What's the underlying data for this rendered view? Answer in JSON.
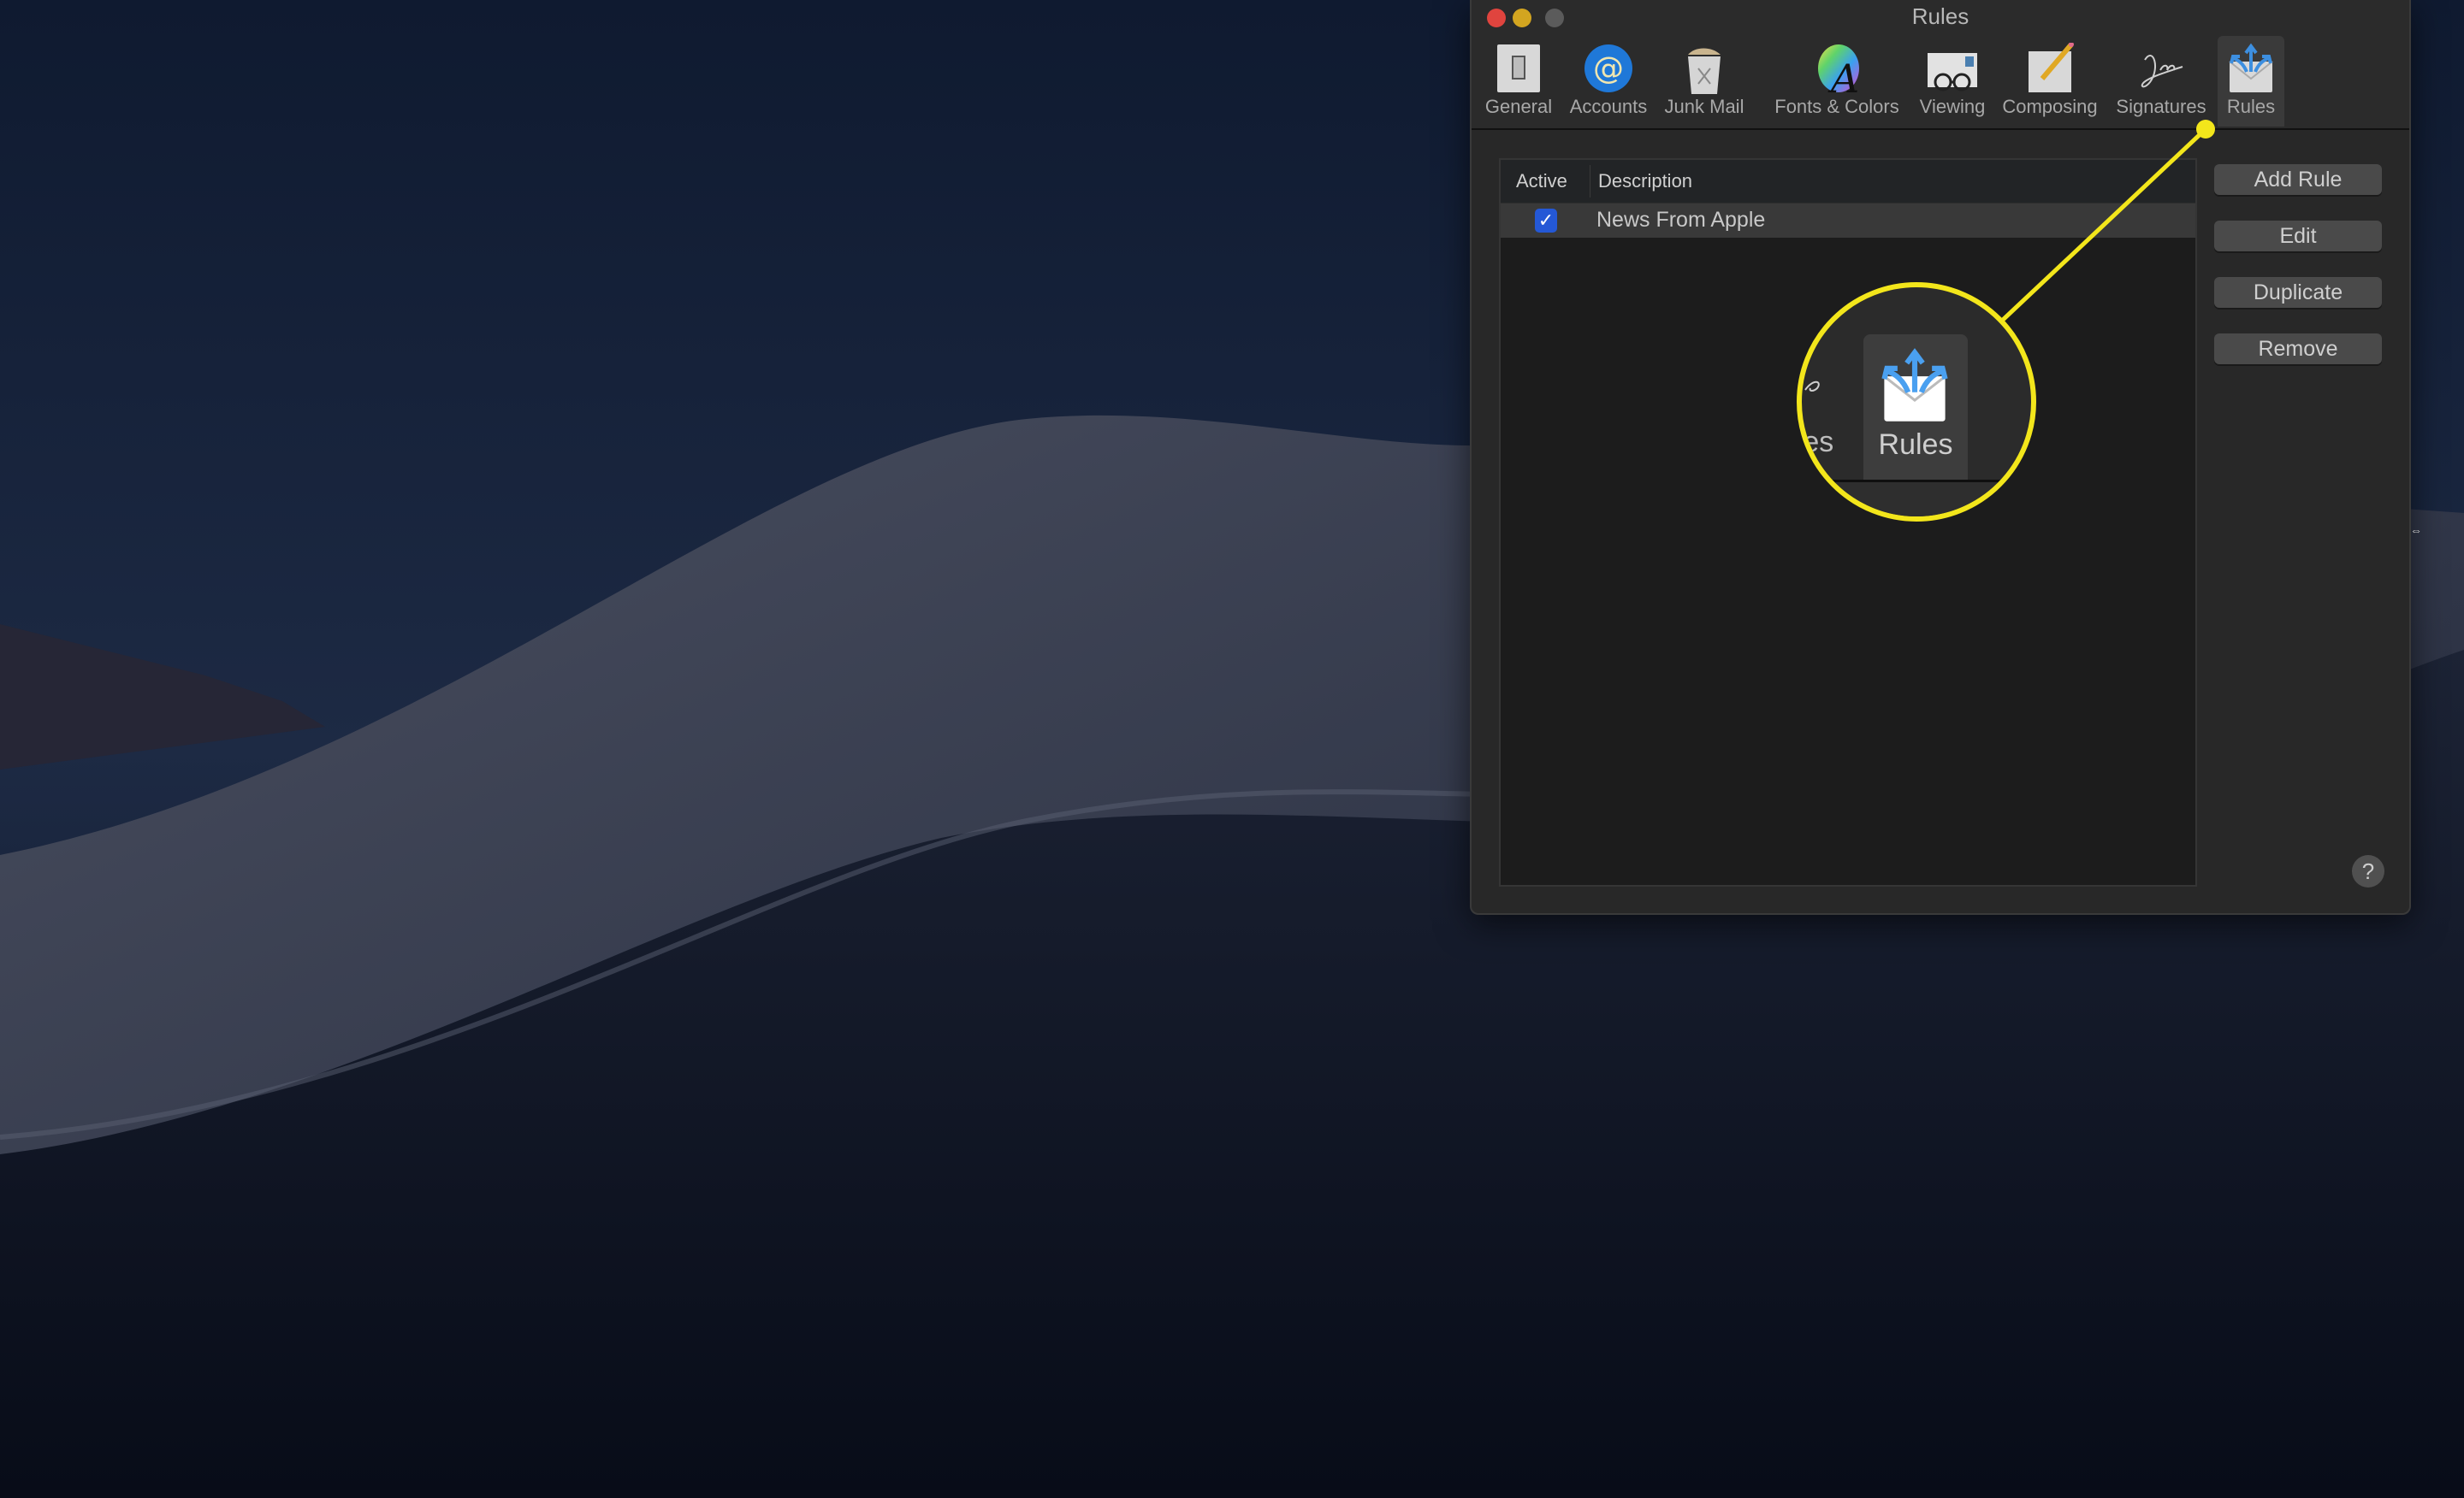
{
  "window": {
    "title": "Rules"
  },
  "toolbar": {
    "items": [
      {
        "label": "General",
        "icon": "general-switch-icon"
      },
      {
        "label": "Accounts",
        "icon": "at-sign-icon"
      },
      {
        "label": "Junk Mail",
        "icon": "trash-can-icon"
      },
      {
        "label": "Fonts & Colors",
        "icon": "font-color-wheel-icon"
      },
      {
        "label": "Viewing",
        "icon": "glasses-envelope-icon"
      },
      {
        "label": "Composing",
        "icon": "pencil-paper-icon"
      },
      {
        "label": "Signatures",
        "icon": "signature-icon"
      },
      {
        "label": "Rules",
        "icon": "rules-envelope-icon",
        "selected": true
      }
    ]
  },
  "rules_table": {
    "columns": [
      "Active",
      "Description"
    ],
    "rows": [
      {
        "active": true,
        "description": "News From Apple"
      }
    ]
  },
  "actions": {
    "add_rule": "Add Rule",
    "edit": "Edit",
    "duplicate": "Duplicate",
    "remove": "Remove",
    "help": "?"
  },
  "callout": {
    "label": "Rules",
    "partial_prev_label": "res",
    "color": "#f3e61b"
  }
}
